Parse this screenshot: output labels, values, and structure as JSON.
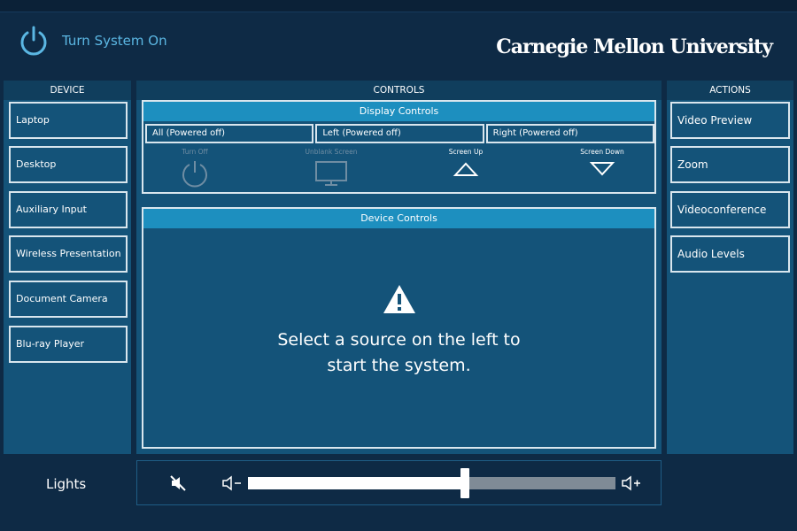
{
  "header": {
    "power_label": "Turn System On",
    "brand": "Carnegie Mellon University"
  },
  "device": {
    "title": "DEVICE",
    "items": [
      {
        "label": "Laptop"
      },
      {
        "label": "Desktop"
      },
      {
        "label": "Auxiliary Input"
      },
      {
        "label": "Wireless Presentation"
      },
      {
        "label": "Document Camera"
      },
      {
        "label": "Blu-ray Player"
      }
    ]
  },
  "controls": {
    "title": "CONTROLS",
    "display": {
      "title": "Display Controls",
      "segments": [
        {
          "label": "All (Powered off)"
        },
        {
          "label": "Left (Powered off)"
        },
        {
          "label": "Right (Powered off)"
        }
      ],
      "turn_off": "Turn Off",
      "unblank": "Unblank Screen",
      "screen_up": "Screen Up",
      "screen_down": "Screen Down"
    },
    "device_controls": {
      "title": "Device Controls",
      "message_line1": "Select a source on the left to",
      "message_line2": "start the system."
    }
  },
  "actions": {
    "title": "ACTIONS",
    "items": [
      {
        "label": "Video Preview"
      },
      {
        "label": "Zoom"
      },
      {
        "label": "Videoconference"
      },
      {
        "label": "Audio Levels"
      }
    ]
  },
  "lights": {
    "label": "Lights",
    "level": 0.59
  },
  "colors": {
    "background": "#0e2a45",
    "panel": "#145379",
    "accent": "#1d8fbf",
    "power_icon": "#5bb7e3"
  },
  "icons": [
    "power-icon",
    "turn-off-icon",
    "monitor-icon",
    "arrow-up-icon",
    "arrow-down-icon",
    "warning-icon",
    "mute-icon",
    "volume-down-icon",
    "volume-up-icon"
  ]
}
